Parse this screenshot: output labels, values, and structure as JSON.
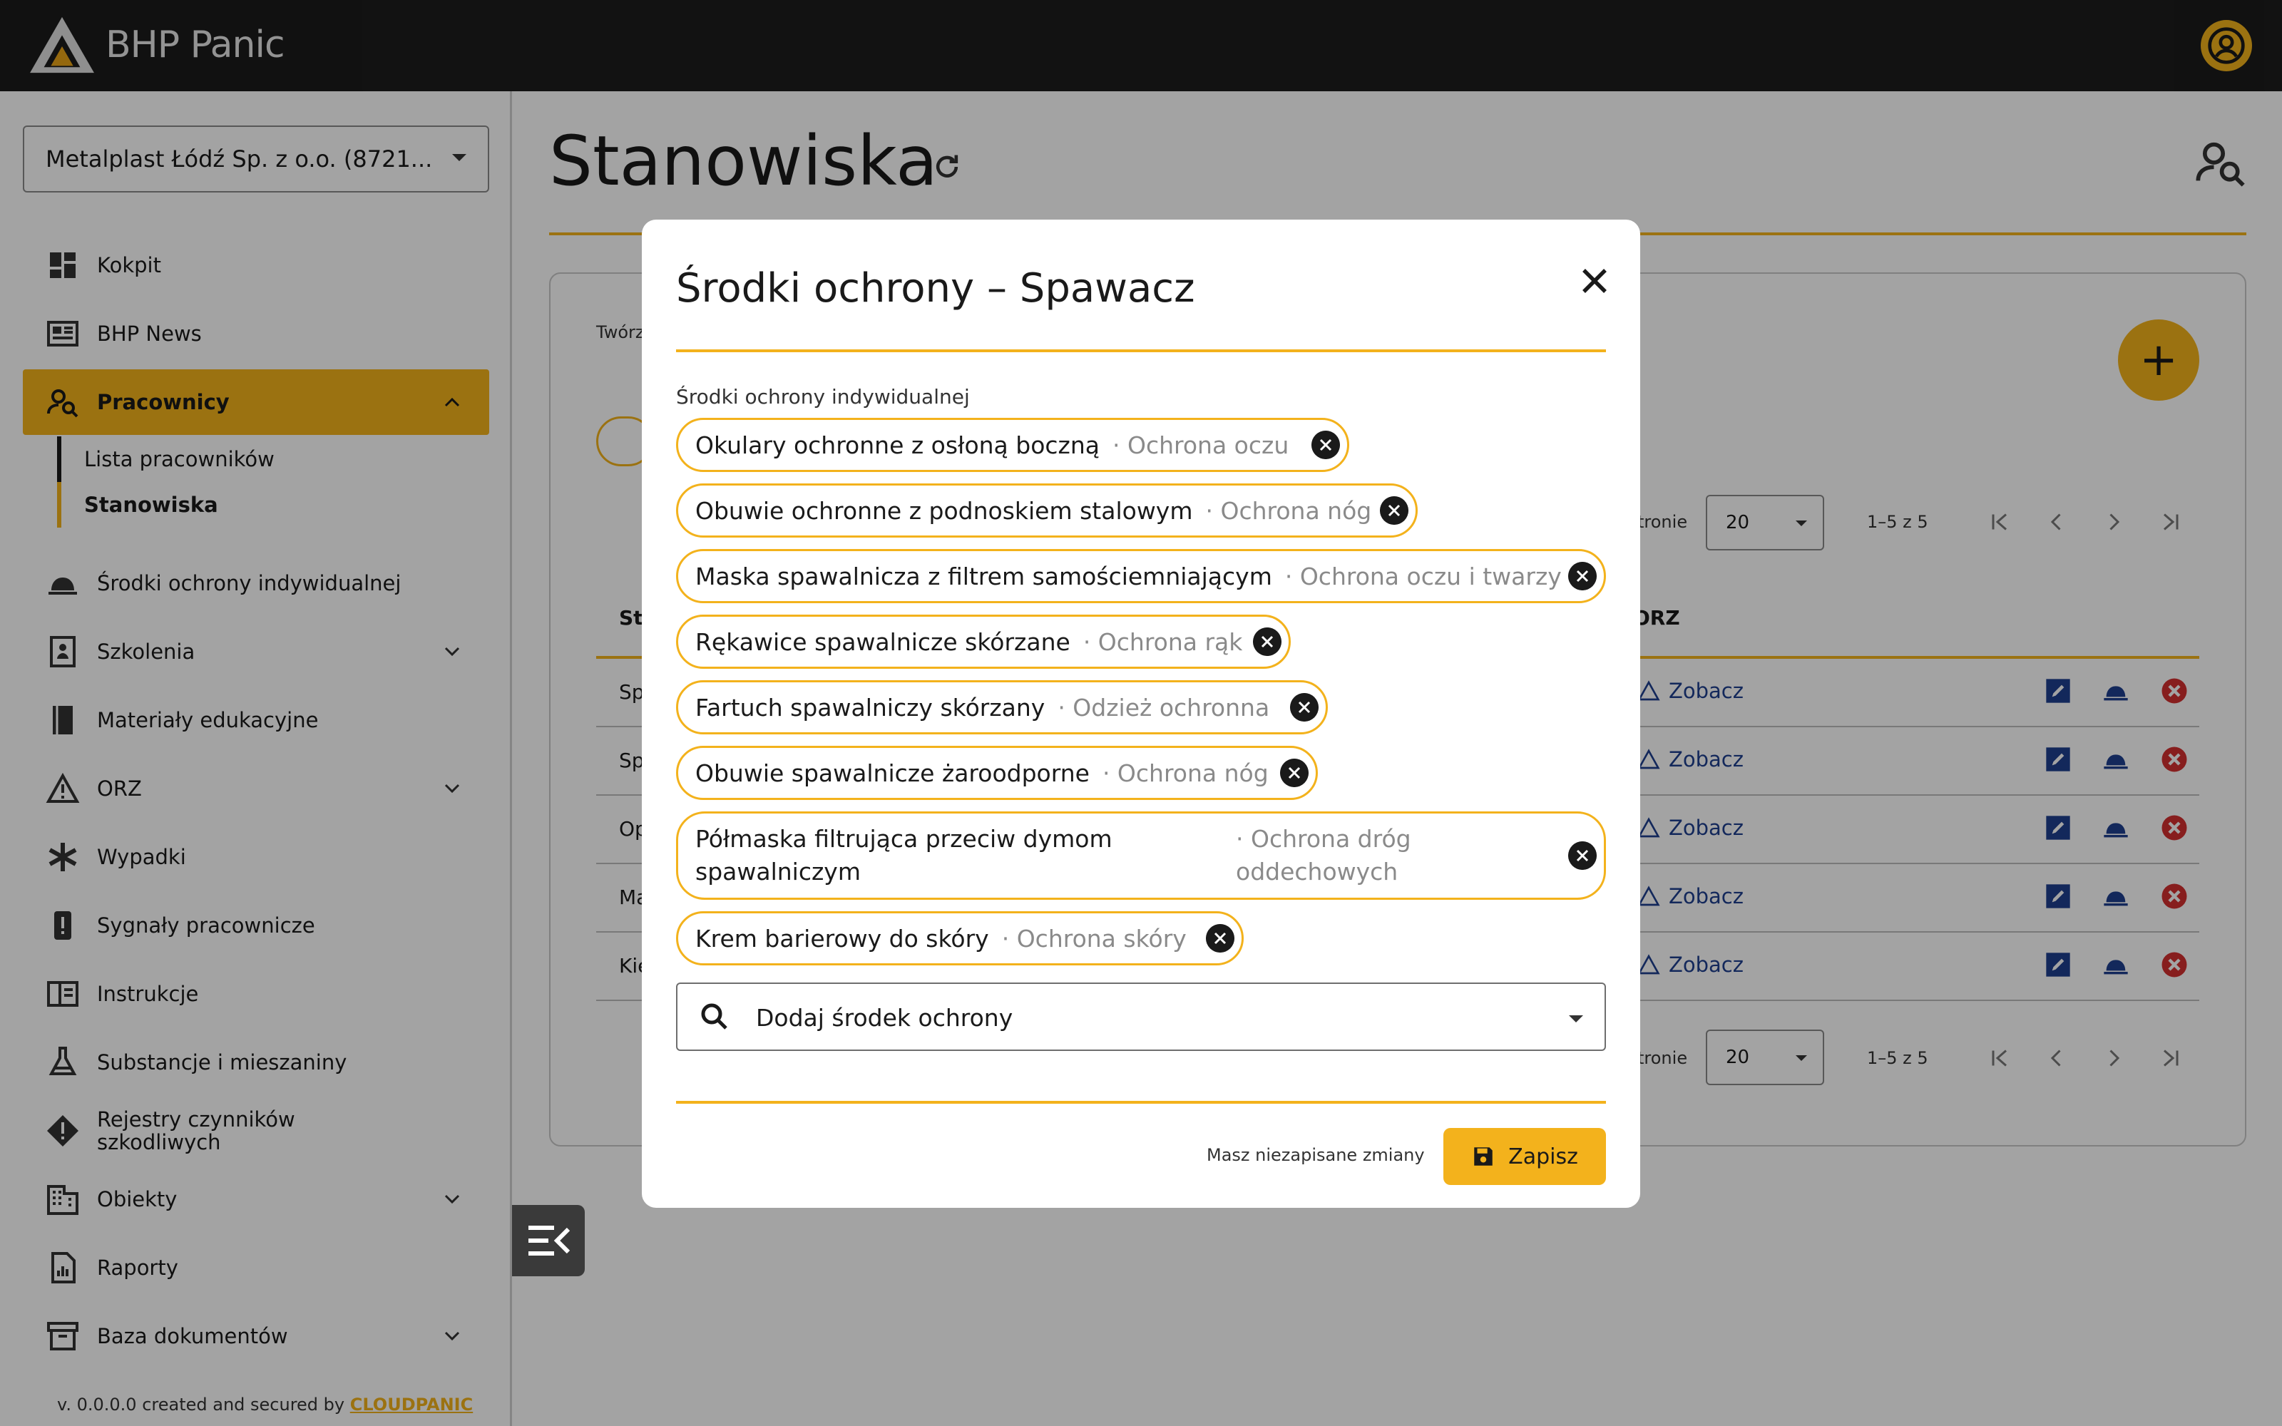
{
  "app": {
    "name": "BHP Panic"
  },
  "company_select": {
    "value": "Metalplast Łódź Sp. z o.o. (8721..."
  },
  "sidebar": {
    "items": [
      {
        "label": "Kokpit"
      },
      {
        "label": "BHP News"
      },
      {
        "label": "Pracownicy"
      },
      {
        "label": "Środki ochrony indywidualnej"
      },
      {
        "label": "Szkolenia"
      },
      {
        "label": "Materiały edukacyjne"
      },
      {
        "label": "ORZ"
      },
      {
        "label": "Wypadki"
      },
      {
        "label": "Sygnały pracownicze"
      },
      {
        "label": "Instrukcje"
      },
      {
        "label": "Substancje i mieszaniny"
      },
      {
        "label": "Rejestry czynników szkodliwych"
      },
      {
        "label": "Obiekty"
      },
      {
        "label": "Raporty"
      },
      {
        "label": "Baza dokumentów"
      }
    ],
    "subitems": [
      {
        "label": "Lista pracowników"
      },
      {
        "label": "Stanowiska"
      }
    ],
    "version_text": "v. 0.0.0.0 created and secured by",
    "version_link": "CLOUDPANIC"
  },
  "main": {
    "title": "Stanowiska",
    "create_label": "Twórz",
    "col_first": "St",
    "col_orz": "ORZ",
    "per_page_label": "tronie",
    "per_page_value": "20",
    "range_text": "1–5 z 5",
    "rows": [
      {
        "name": "Sp",
        "link": "Zobacz"
      },
      {
        "name": "Sp",
        "link": "Zobacz"
      },
      {
        "name": "Op",
        "link": "Zobacz"
      },
      {
        "name": "Ma",
        "link": "Zobacz"
      },
      {
        "name": "Kie",
        "link": "Zobacz"
      }
    ]
  },
  "dialog": {
    "title": "Środki ochrony – Spawacz",
    "section_label": "Środki ochrony indywidualnej",
    "chips": [
      {
        "name": "Okulary ochronne z osłoną boczną",
        "category": "· Ochrona oczu"
      },
      {
        "name": "Obuwie ochronne z podnoskiem stalowym",
        "category": "· Ochrona nóg"
      },
      {
        "name": "Maska spawalnicza z filtrem samościemniającym",
        "category": "· Ochrona oczu i twarzy"
      },
      {
        "name": "Rękawice spawalnicze skórzane",
        "category": "· Ochrona rąk"
      },
      {
        "name": "Fartuch spawalniczy skórzany",
        "category": "· Odzież ochronna"
      },
      {
        "name": "Obuwie spawalnicze żaroodporne",
        "category": "· Ochrona nóg"
      },
      {
        "name": "Półmaska filtrująca przeciw dymom spawalniczym",
        "category": "· Ochrona dróg oddechowych"
      },
      {
        "name": "Krem barierowy do skóry",
        "category": "· Ochrona skóry"
      }
    ],
    "add_placeholder": "Dodaj środek ochrony",
    "unsaved_text": "Masz niezapisane zmiany",
    "save_label": "Zapisz"
  },
  "colors": {
    "accent": "#f3b21c",
    "topbar": "#1c1c1c",
    "link": "#1f3f8f",
    "danger": "#d32f2f"
  }
}
